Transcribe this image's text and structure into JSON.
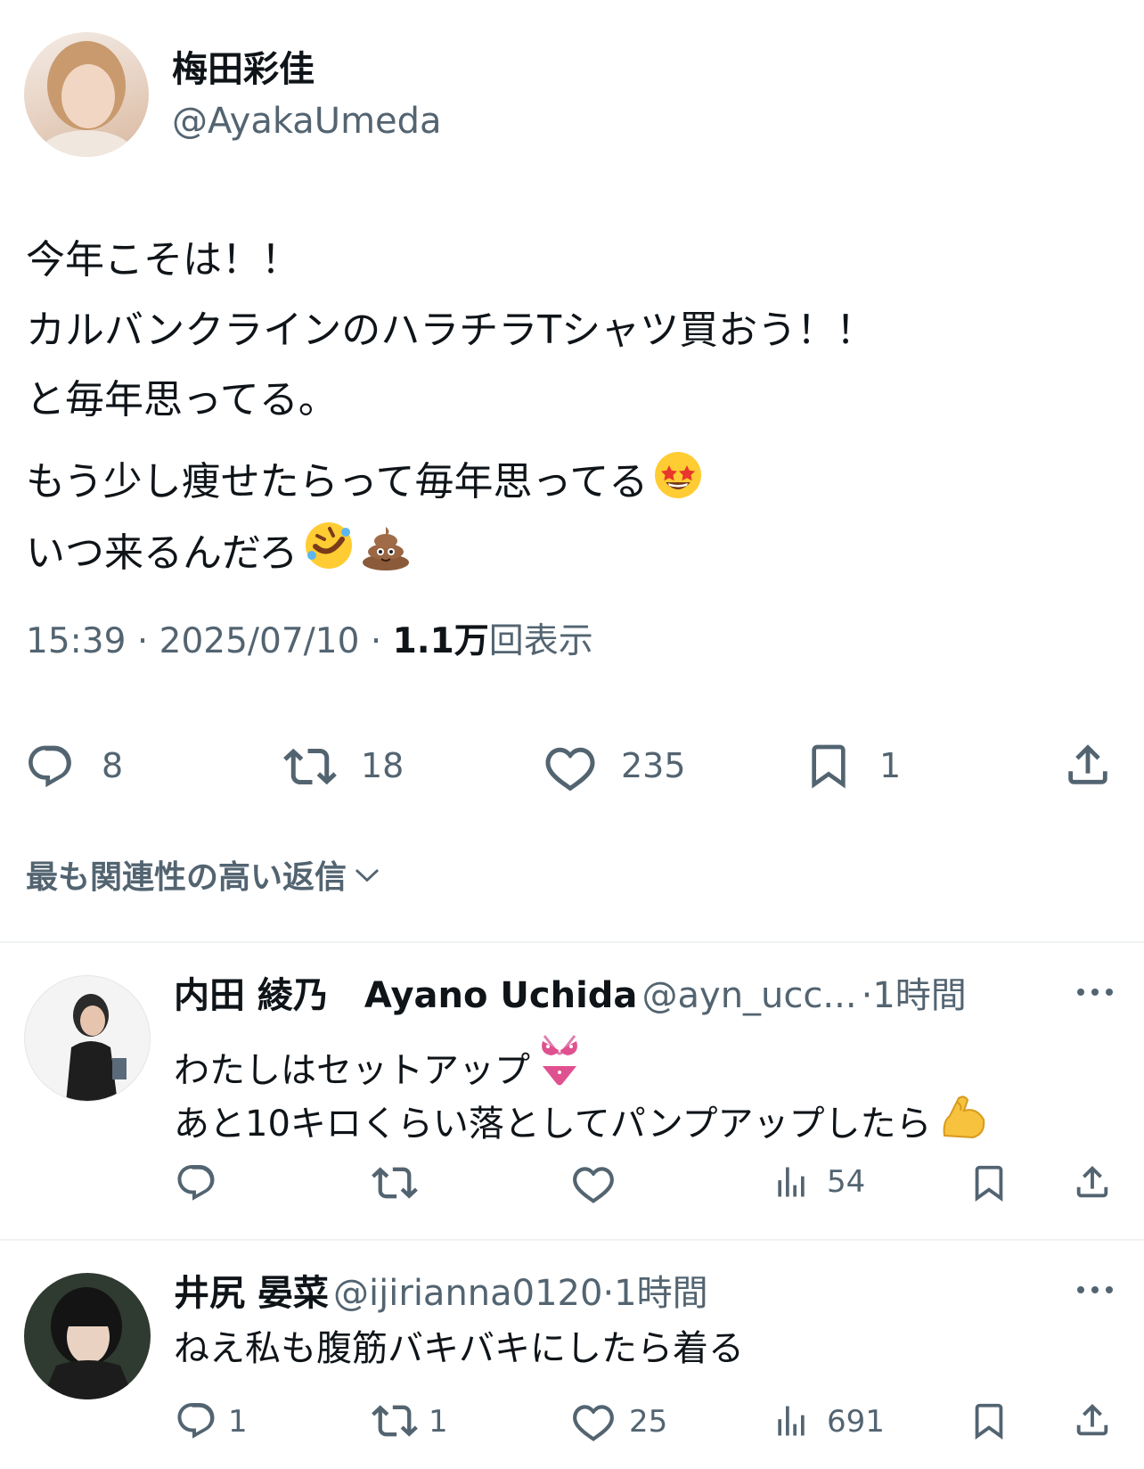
{
  "tweet": {
    "author_name": "梅田彩佳",
    "author_handle": "@AyakaUmeda",
    "lines": [
      "今年こそは！！",
      "カルバンクラインのハラチラTシャツ買おう！！",
      "と毎年思ってる。",
      "もう少し痩せたらって毎年思ってる",
      "いつ来るんだろ"
    ],
    "time": "15:39",
    "date": "2025/07/10",
    "views_count": "1.1万",
    "views_label": "回表示",
    "sep": "·",
    "stats": {
      "replies": "8",
      "retweets": "18",
      "likes": "235",
      "bookmarks": "1"
    }
  },
  "sort": {
    "label": "最も関連性の高い返信"
  },
  "replies": [
    {
      "name": "内田 綾乃　Ayano Uchida",
      "handle": "@ayn_ucc...",
      "time": "1時間",
      "lines": [
        "わたしはセットアップ",
        "あと10キロくらい落としてパンプアップしたら"
      ],
      "stats": {
        "replies": "",
        "retweets": "",
        "likes": "",
        "views": "54"
      }
    },
    {
      "name": "井尻 晏菜",
      "handle": "@ijirianna0120",
      "time": "1時間",
      "lines": [
        "ねえ私も腹筋バキバキにしたら着る"
      ],
      "stats": {
        "replies": "1",
        "retweets": "1",
        "likes": "25",
        "views": "691"
      }
    }
  ],
  "colors": {
    "text": "#0f1419",
    "muted": "#536471",
    "divider": "#eff3f4"
  }
}
